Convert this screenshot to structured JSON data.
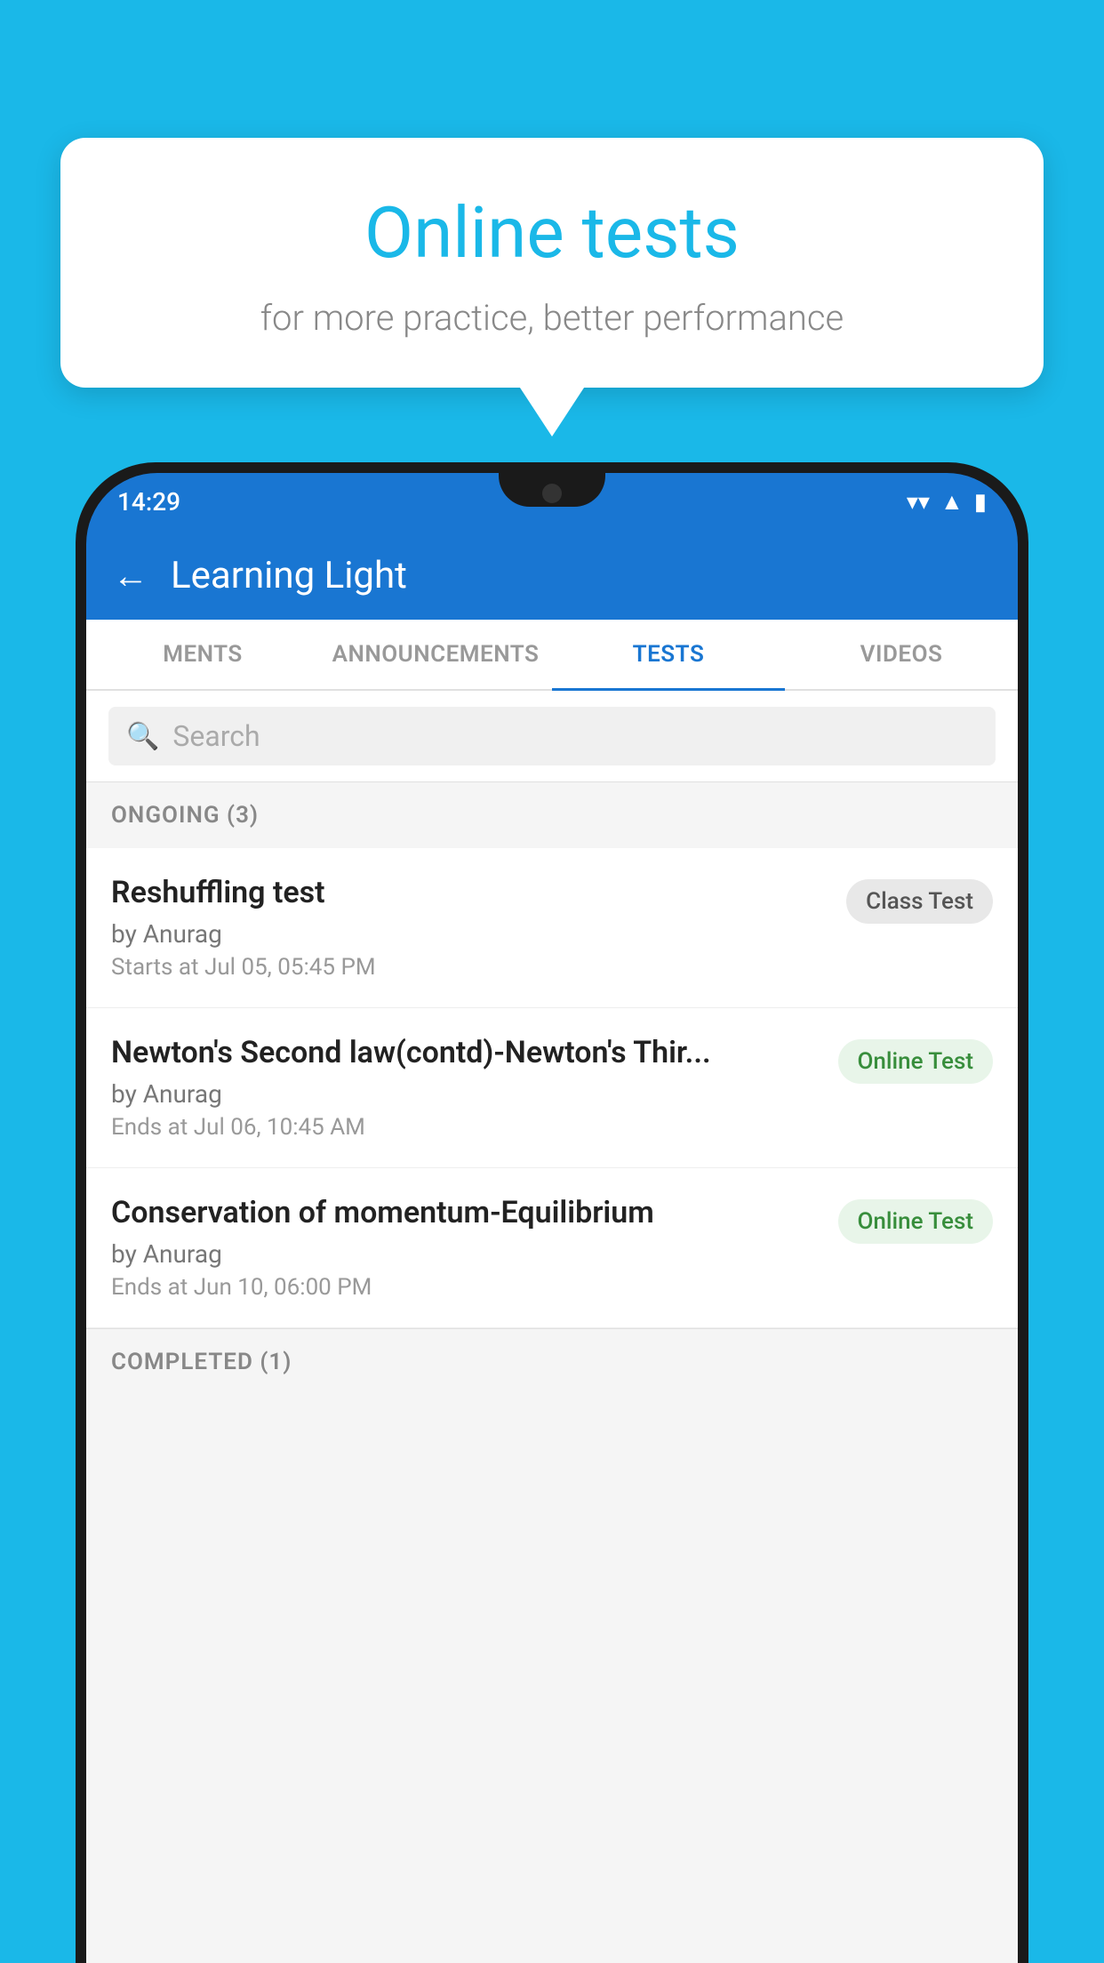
{
  "background": {
    "color": "#1ab8e8"
  },
  "bubble": {
    "title": "Online tests",
    "subtitle": "for more practice, better performance"
  },
  "status_bar": {
    "time": "14:29",
    "wifi_icon": "▼",
    "signal_icon": "▲",
    "battery_icon": "▮"
  },
  "header": {
    "back_label": "←",
    "title": "Learning Light"
  },
  "tabs": [
    {
      "label": "MENTS",
      "active": false
    },
    {
      "label": "ANNOUNCEMENTS",
      "active": false
    },
    {
      "label": "TESTS",
      "active": true
    },
    {
      "label": "VIDEOS",
      "active": false
    }
  ],
  "search": {
    "placeholder": "Search"
  },
  "ongoing": {
    "section_label": "ONGOING (3)",
    "items": [
      {
        "name": "Reshuffling test",
        "author": "by Anurag",
        "date": "Starts at  Jul 05, 05:45 PM",
        "badge": "Class Test",
        "badge_type": "class"
      },
      {
        "name": "Newton's Second law(contd)-Newton's Thir...",
        "author": "by Anurag",
        "date": "Ends at  Jul 06, 10:45 AM",
        "badge": "Online Test",
        "badge_type": "online"
      },
      {
        "name": "Conservation of momentum-Equilibrium",
        "author": "by Anurag",
        "date": "Ends at  Jun 10, 06:00 PM",
        "badge": "Online Test",
        "badge_type": "online"
      }
    ]
  },
  "completed": {
    "section_label": "COMPLETED (1)"
  }
}
